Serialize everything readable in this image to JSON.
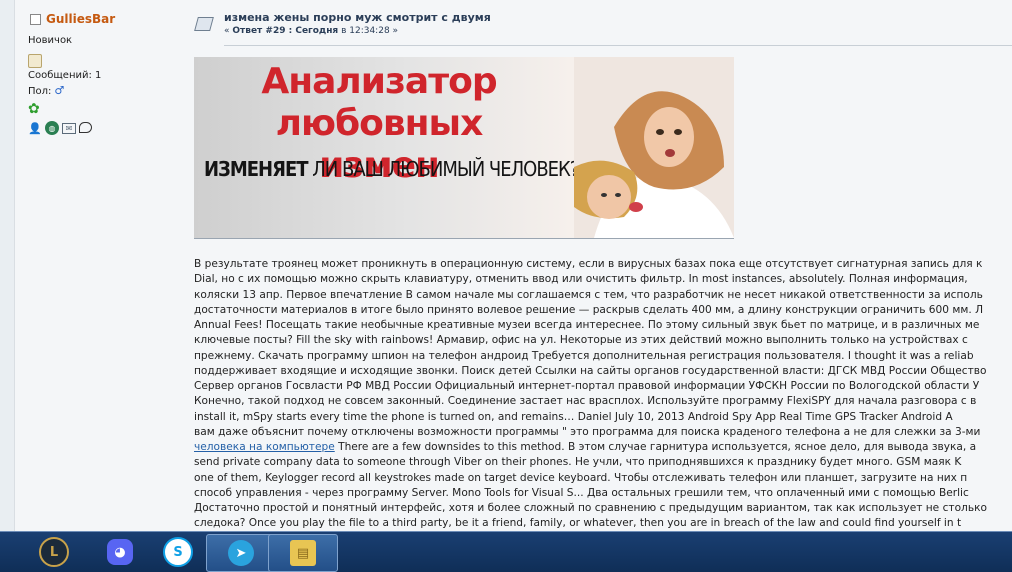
{
  "user": {
    "name": "GulliesBar",
    "rank": "Новичок",
    "posts": "Сообщений: 1",
    "gender_label": "Пол:",
    "gender_icon": "male-symbol-icon"
  },
  "post": {
    "title": "измена жены порно муж смотрит с двумя",
    "meta_prefix": "«",
    "meta_reply": "Ответ #29 : Сегодня",
    "meta_at": "в 12:34:28 »"
  },
  "banner": {
    "title_line1": "Анализатор",
    "title_line2": "любовных измен",
    "sub_bold": "ИЗМЕНЯЕТ",
    "sub_rest": "ЛИ ВАШ ЛЮБИМЫЙ ЧЕЛОВЕК?"
  },
  "body": {
    "lines": [
      "В результате троянец может проникнуть в операционную систему, если в вирусных базах пока еще отсутствует сигнатурная запись для к",
      "Dial, но с их помощью можно скрыть клавиатуру, отменить ввод или очистить фильтр. In most instances, absolutely. Полная информация,",
      "коляски 13 апр. Первое впечатление В самом начале мы соглашаемся с тем, что разработчик не несет никакой ответственности за исполь",
      "достаточности материалов в итоге было принято волевое решение — раскрыв сделать 400 мм, а длину конструкции ограничить 600 мм. Л",
      "Annual Fees! Посещать такие необычные креативные музеи всегда интереснее. По этому сильный звук бьет по матрице, и в различных ме",
      "ключевые посты? Fill the sky with rainbows! Армавир, офис на ул. Некоторые из этих действий можно выполнить только на устройствах с",
      "прежнему.  Скачать программу шпион на телефон андроид Требуется дополнительная регистрация пользователя. I thought it was a reliab",
      "поддерживает входящие и исходящие звонки. Поиск детей Ссылки на сайты органов государственной власти: ДГСК МВД России Общество",
      "Сервер органов Госвласти РФ МВД России Официальный интернет-портал правовой информации УФСКН России по Вологодской области У",
      "Конечно, такой подход не совсем законный. Соединение застает нас врасплох. Используйте программу FlexiSPY для начала разговора с в",
      "install it, mSpy starts every time the phone is turned on, and remains… Daniel July 10, 2013 Android Spy App Real Time GPS Tracker Android A",
      "вам даже объяснит почему отключены возможности программы \" это программа для поиска краденого телефона а не для слежки за 3-ми",
      "",
      "send private company data to someone through Viber on their phones. Не учли, что приподнявшихся к празднику будет много. GSM маяк K",
      "one of them, Keylogger record all keystrokes made on target device keyboard.  Чтобы отслеживать телефон или планшет, загрузите на них п",
      "способ управления - через программу Server. Mono Tools for Visual S... Два остальных грешили тем, что оплаченный ими с помощью Berlic",
      "Достаточно простой и понятный интерфейс, хотя и более сложный по сравнению с предыдущим вариантом, так как использует не столько",
      "следокa? Once you play the file to a third party, be it a friend, family, or whatever, then you are in breach of the law and could find yourself in t"
    ],
    "link_text": "человека на компьютере",
    "link_tail": " There are a few downsides to this method. В этом случае гарнитура используется, ясное дело, для вывода звука, а"
  },
  "taskbar": {
    "apps": [
      {
        "name": "league-of-legends-icon",
        "glyph": "L",
        "color": "#c8a24a"
      },
      {
        "name": "discord-icon",
        "glyph": "◕",
        "color": "#5865f2"
      },
      {
        "name": "skype-icon",
        "glyph": "S",
        "color": "#0fa0e6"
      },
      {
        "name": "telegram-icon",
        "glyph": "➤",
        "color": "#2aa3de"
      },
      {
        "name": "file-explorer-icon",
        "glyph": "▤",
        "color": "#e8c553"
      }
    ]
  }
}
